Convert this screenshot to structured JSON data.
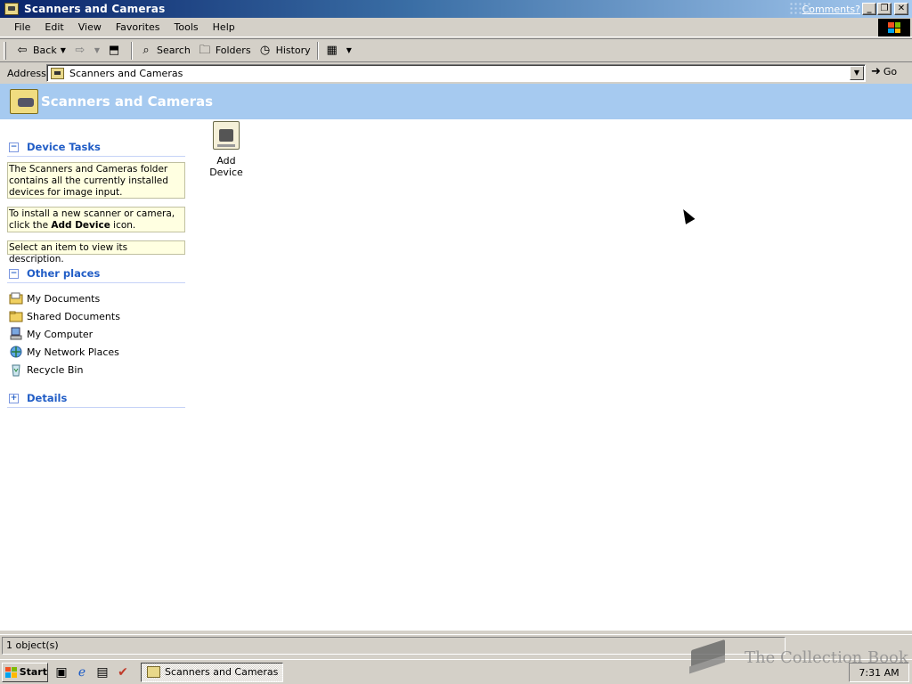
{
  "window": {
    "title": "Scanners and Cameras",
    "comments_link": "Comments?",
    "controls": {
      "minimize": "_",
      "restore": "❐",
      "close": "✕"
    }
  },
  "menu": [
    "File",
    "Edit",
    "View",
    "Favorites",
    "Tools",
    "Help"
  ],
  "toolbar": {
    "back": "Back",
    "search": "Search",
    "folders": "Folders",
    "history": "History"
  },
  "address": {
    "label": "Address",
    "value": "Scanners and Cameras",
    "go": "Go"
  },
  "banner": {
    "title": "Scanners and Cameras"
  },
  "left_pane": {
    "device_tasks": {
      "heading": "Device Tasks",
      "note1": "The Scanners and Cameras folder contains all the currently installed devices for image input.",
      "note2_prefix": "To install a new scanner or camera, click the ",
      "note2_bold": "Add Device",
      "note2_suffix": " icon.",
      "note3": "Select an item to view its description."
    },
    "other_places": {
      "heading": "Other places",
      "items": [
        "My Documents",
        "Shared Documents",
        "My Computer",
        "My Network Places",
        "Recycle Bin"
      ]
    },
    "details": {
      "heading": "Details"
    }
  },
  "main": {
    "items": [
      {
        "label": "Add Device"
      }
    ]
  },
  "status": {
    "text": "1 object(s)"
  },
  "taskbar": {
    "start": "Start",
    "task": "Scanners and Cameras",
    "clock": "7:31 AM"
  },
  "watermark": "The Collection Book",
  "colors": {
    "banner": "#a6caf0",
    "link": "#215dc6",
    "note_bg": "#ffffe1"
  }
}
